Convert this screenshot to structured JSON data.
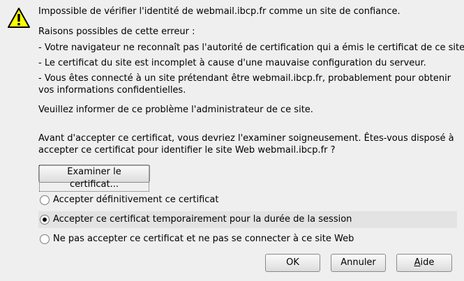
{
  "icon": "warning-triangle-icon",
  "message": {
    "title": "Impossible de vérifier l'identité de webmail.ibcp.fr comme un site de confiance.",
    "reasons_header": "Raisons possibles de cette erreur :",
    "reason_1": "- Votre navigateur ne reconnaît pas l'autorité de certification qui a émis le certificat de ce site.",
    "reason_2": "- Le certificat du site est incomplet à cause d'une mauvaise configuration du serveur.",
    "reason_3_line1": "- Vous êtes connecté à un site prétendant être webmail.ibcp.fr, probablement pour obtenir",
    "reason_3_line2": "vos informations confidentielles.",
    "inform": "Veuillez informer de ce problème l'administrateur de ce site.",
    "question_line1": "Avant d'accepter ce certificat, vous devriez l'examiner soigneusement. Êtes-vous disposé à",
    "question_line2": "accepter ce certificat pour identifier le site Web webmail.ibcp.fr ?"
  },
  "examine_button": "Examiner le certificat...",
  "options": [
    {
      "label": "Accepter définitivement ce certificat",
      "selected": false
    },
    {
      "label": "Accepter ce certificat temporairement pour la durée de la session",
      "selected": true
    },
    {
      "label": "Ne pas accepter ce certificat et ne pas se connecter à ce site Web",
      "selected": false
    }
  ],
  "buttons": {
    "ok": "OK",
    "cancel": "Annuler",
    "help_first": "A",
    "help_rest": "ide"
  },
  "colors": {
    "background": "#efefef",
    "warning_fill": "#ffff00",
    "selected_row": "#e3e3e3"
  }
}
